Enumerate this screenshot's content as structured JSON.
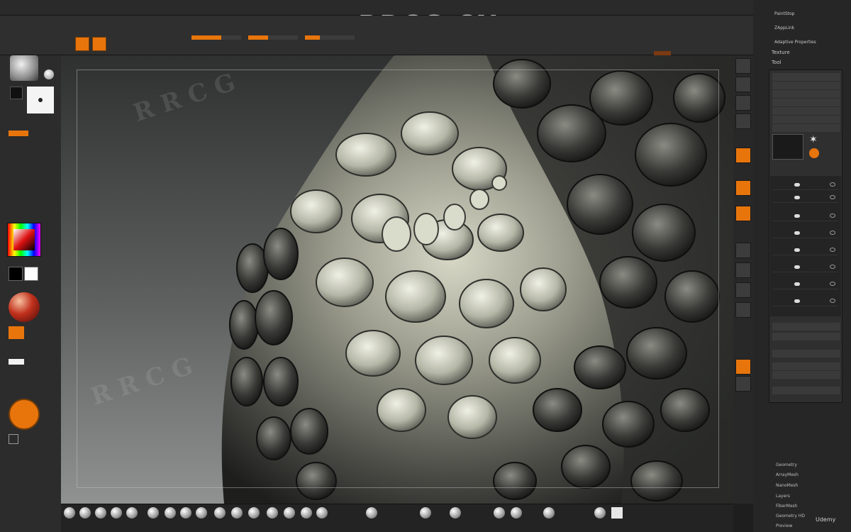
{
  "brand": {
    "site_watermark": "RRCG.CN",
    "udemy": "Udemy"
  },
  "rightcol": {
    "top_items": [
      "PaintStop",
      "ZAppLink",
      "Adaptive Properties"
    ],
    "texture_label": "Texture",
    "tool_label": "Tool",
    "bottom_items": [
      "Geometry",
      "ArrayMesh",
      "NanoMesh",
      "Layers",
      "FiberMesh",
      "Geometry HD",
      "Preview"
    ]
  },
  "colors": {
    "accent": "#e8750c",
    "background": "#1e1e1e",
    "panel": "#2c2c2c"
  }
}
